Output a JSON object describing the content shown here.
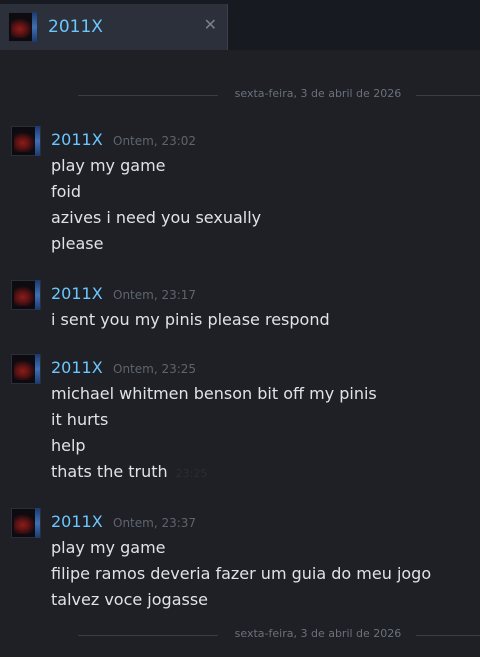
{
  "tab": {
    "title": "2011X",
    "close_glyph": "✕",
    "avatar_icon": "user-avatar-icon"
  },
  "date_dividers": [
    "sexta-feira, 3 de abril de 2026",
    "sexta-feira, 3 de abril de 2026"
  ],
  "colors": {
    "accent": "#6cc6ff",
    "background": "#1e2025",
    "tab_background": "#2b303a",
    "message_text": "#dfe3e8",
    "timestamp": "#5e646e"
  },
  "messages": [
    {
      "sender": "2011X",
      "time": "Ontem, 23:02",
      "lines": [
        "play my game",
        "foid",
        "azives i need you sexually",
        "please"
      ]
    },
    {
      "sender": "2011X",
      "time": "Ontem, 23:17",
      "lines": [
        "i sent you my pinis please respond"
      ]
    },
    {
      "sender": "2011X",
      "time": "Ontem, 23:25",
      "lines": [
        "michael whitmen benson bit off my pinis",
        "it hurts",
        "help",
        "thats the truth"
      ],
      "hover_time": "23:25"
    },
    {
      "sender": "2011X",
      "time": "Ontem, 23:37",
      "lines": [
        "play my game",
        "filipe ramos deveria fazer um guia do meu jogo",
        "talvez voce jogasse"
      ]
    }
  ]
}
